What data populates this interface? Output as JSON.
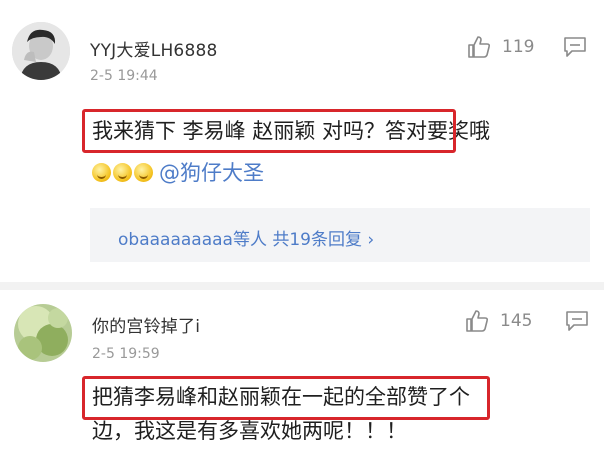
{
  "comments": [
    {
      "username": "YYJ大爱LH6888",
      "time": "2-5 19:44",
      "likes": "119",
      "text_line1_highlighted": "我来猜下 李易峰 赵丽颖 对吗？",
      "text_line1_rest": "答对要奖哦",
      "mention": "@狗仔大圣",
      "emoji_count": 3,
      "replies": "obaaaaaaaaa等人 共19条回复 ›"
    },
    {
      "username": "你的宫铃掉了i",
      "time": "2-5 19:59",
      "likes": "145",
      "text_line1": "把猜李易峰和赵丽颖在一起的全部赞了个",
      "text_line2": "边，我这是有多喜欢她两呢！！！"
    }
  ],
  "colors": {
    "highlight": "#d8262b",
    "link": "#4e7cc8",
    "meta": "#999999"
  },
  "icons": [
    "thumbs-up-icon",
    "reply-icon",
    "emoji-icon"
  ]
}
